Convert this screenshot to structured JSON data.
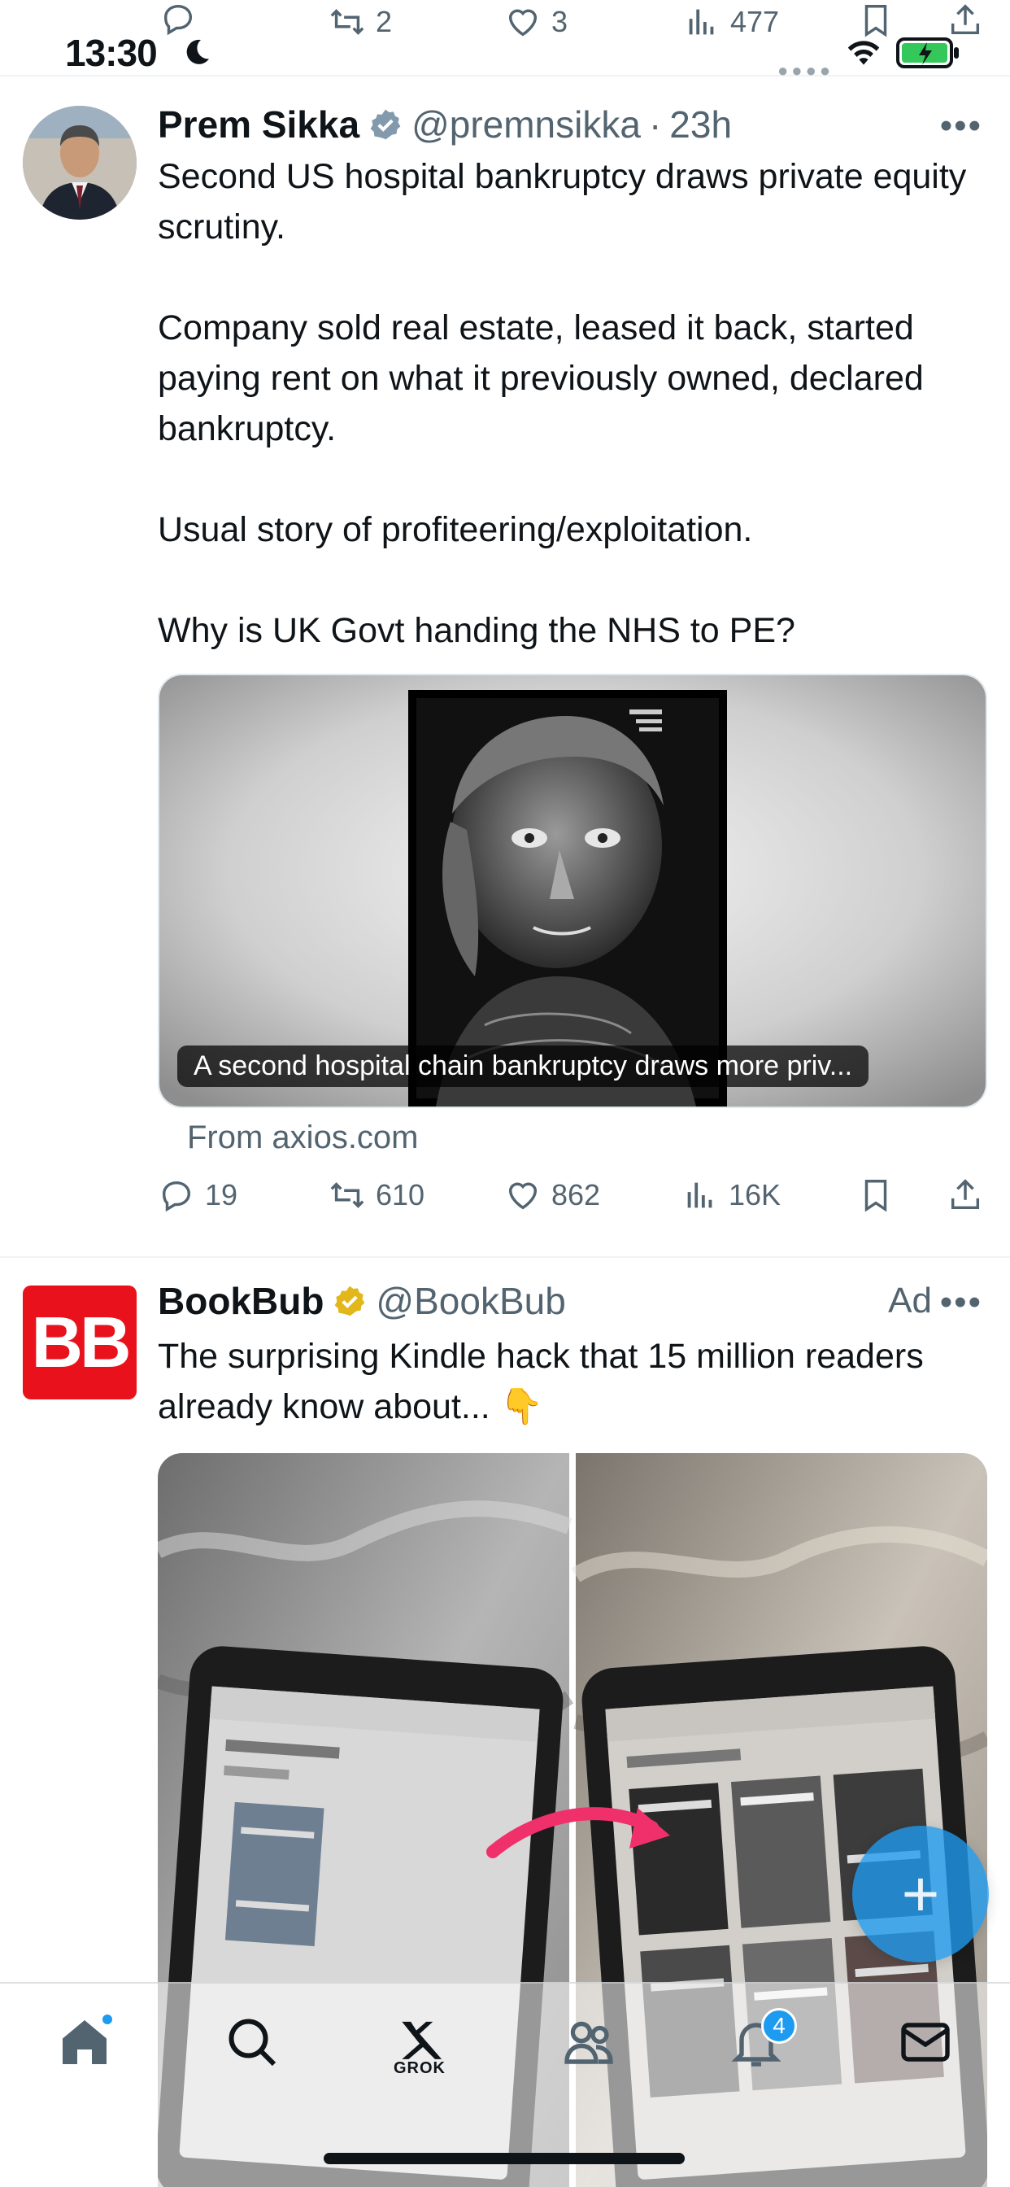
{
  "status_bar": {
    "time": "13:30"
  },
  "previous_tweet_actions": {
    "retweets": "2",
    "likes": "3",
    "views": "477"
  },
  "tweets": [
    {
      "name": "Prem Sikka",
      "handle": "@premnsikka",
      "separator": "·",
      "time": "23h",
      "verified_color": "#829aab",
      "text": "Second US hospital bankruptcy draws private equity scrutiny.\n\nCompany sold real estate, leased it back, started paying rent on what it previously owned, declared bankruptcy.\n\nUsual story of profiteering/exploitation.\n\nWhy is UK Govt handing the NHS to PE?",
      "card_caption": "A second hospital chain bankruptcy draws more priv...",
      "card_source": "From axios.com",
      "stats": {
        "replies": "19",
        "retweets": "610",
        "likes": "862",
        "views": "16K"
      }
    },
    {
      "name": "BookBub",
      "handle": "@BookBub",
      "ad_label": "Ad",
      "verified_color": "#e2b719",
      "avatar_text": "BB",
      "avatar_color": "#e8111c",
      "text": "The surprising Kindle hack that 15 million readers already know about...  👇"
    }
  ],
  "bottom_nav": {
    "grok_label": "GROK",
    "notifications_count": "4"
  },
  "colors": {
    "accent": "#1d9bf0",
    "icon_gray": "#536471"
  }
}
